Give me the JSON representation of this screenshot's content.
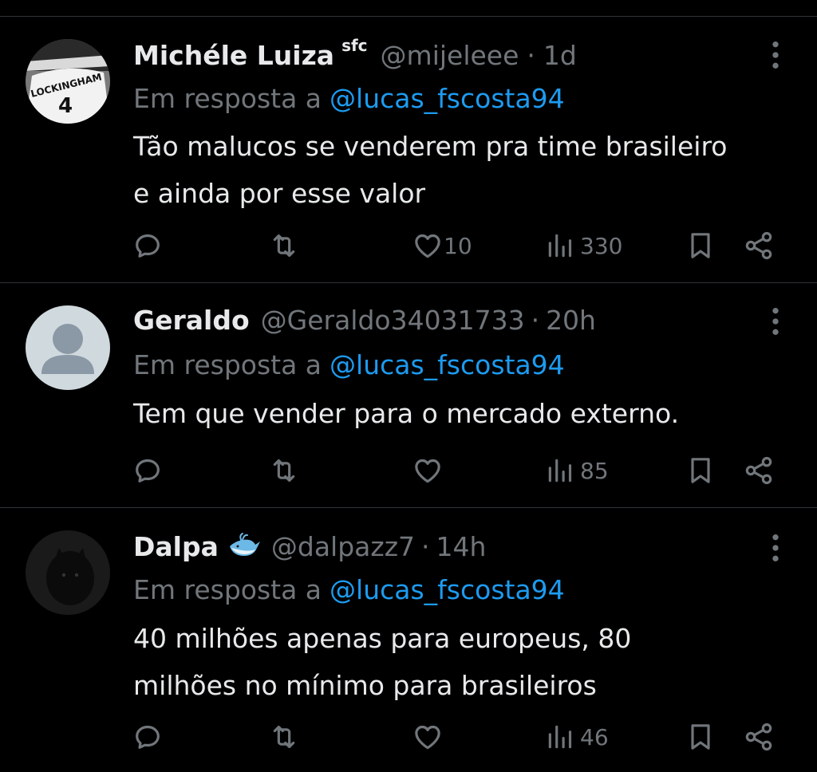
{
  "colors": {
    "background": "#000000",
    "text": "#e7e9ea",
    "muted": "#71767b",
    "link": "#1d9bf0",
    "divider": "#2f3336"
  },
  "replies": [
    {
      "name": "Michéle Luiza",
      "badge": "sfc",
      "handle": "@mijeleee",
      "time_sep": "·",
      "time": "1d",
      "reply_prefix": "Em resposta a",
      "reply_to": "@lucas_fscosta94",
      "text_lines": [
        "Tão malucos se venderem pra time brasileiro",
        "e ainda por esse valor"
      ],
      "likes": "10",
      "views": "330",
      "avatar_icon": "jersey-avatar",
      "avatar_text": "LOCKINGHAM",
      "avatar_number": "4"
    },
    {
      "name": "Geraldo",
      "handle": "@Geraldo34031733",
      "time_sep": "·",
      "time": "20h",
      "reply_prefix": "Em resposta a",
      "reply_to": "@lucas_fscosta94",
      "text_lines": [
        "Tem que vender para o mercado externo."
      ],
      "likes": "",
      "views": "85",
      "avatar_icon": "default-person-avatar"
    },
    {
      "name": "Dalpa",
      "emoji_icon": "whale-emoji-icon",
      "handle": "@dalpazz7",
      "time_sep": "·",
      "time": "14h",
      "reply_prefix": "Em resposta a",
      "reply_to": "@lucas_fscosta94",
      "text_lines": [
        "40 milhões apenas para europeus, 80",
        "milhões no mínimo para brasileiros"
      ],
      "likes": "",
      "views": "46",
      "avatar_icon": "dark-cat-avatar"
    }
  ],
  "icons": {
    "reply": "reply-icon",
    "retweet": "retweet-icon",
    "like": "like-icon",
    "views": "views-icon",
    "bookmark": "bookmark-icon",
    "share": "share-icon",
    "more": "more-icon"
  }
}
